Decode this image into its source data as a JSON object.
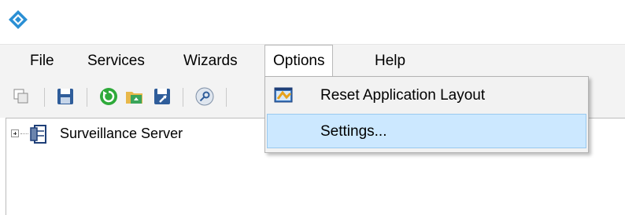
{
  "window": {
    "icon": "diamond-app-icon"
  },
  "menubar": {
    "items": [
      {
        "label": "File"
      },
      {
        "label": "Services"
      },
      {
        "label": "Wizards"
      },
      {
        "label": "Options"
      },
      {
        "label": "Help"
      }
    ],
    "open_menu": "Options"
  },
  "toolbar": {
    "icons": [
      "copy-icon",
      "save-icon",
      "refresh-icon",
      "open-folder-icon",
      "save-as-icon",
      "key-icon"
    ]
  },
  "tree": {
    "items": [
      {
        "label": "Surveillance Server",
        "icon": "server-icon",
        "expanded": false
      }
    ]
  },
  "dropdown": {
    "items": [
      {
        "label": "Reset Application Layout",
        "icon": "reset-layout-icon",
        "highlighted": false
      },
      {
        "label": "Settings...",
        "icon": "",
        "highlighted": true
      }
    ]
  },
  "colors": {
    "menubar_bg": "#f3f3f3",
    "highlight_bg": "#cce8ff",
    "highlight_border": "#99c9ef",
    "app_icon": "#2a8fd4"
  }
}
